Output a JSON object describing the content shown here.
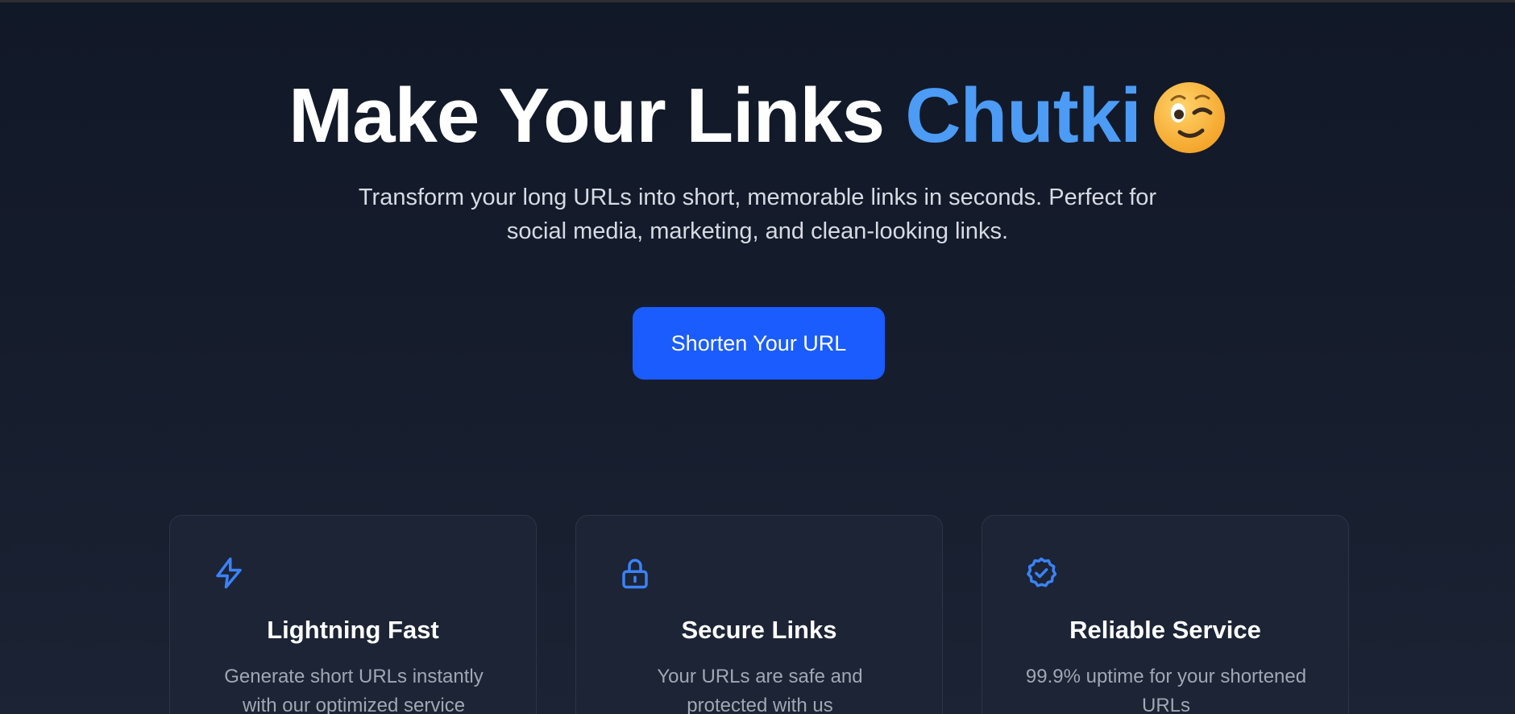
{
  "hero": {
    "title_plain": "Make Your Links",
    "title_accent": "Chutki",
    "emoji_icon": "winking-face-emoji",
    "subtitle": "Transform your long URLs into short, memorable links in seconds. Perfect for social media, marketing, and clean-looking links.",
    "cta_label": "Shorten Your URL"
  },
  "features": [
    {
      "icon": "lightning-icon",
      "title": "Lightning Fast",
      "description": "Generate short URLs instantly with our optimized service"
    },
    {
      "icon": "lock-icon",
      "title": "Secure Links",
      "description": "Your URLs are safe and protected with us"
    },
    {
      "icon": "badge-check-icon",
      "title": "Reliable Service",
      "description": "99.9% uptime for your shortened URLs"
    }
  ],
  "colors": {
    "accent": "#4c9bf5",
    "button": "#1a5cff",
    "icon": "#3b82f6",
    "background": "#151c2c"
  }
}
